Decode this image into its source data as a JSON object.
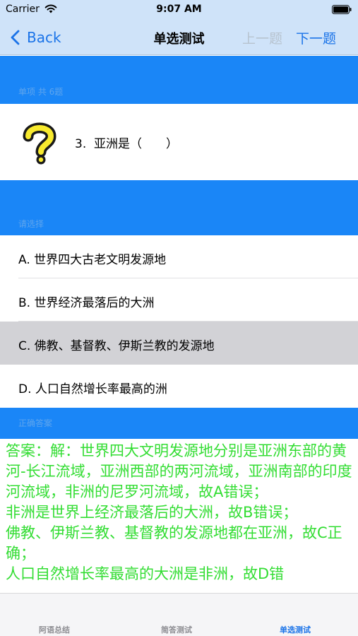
{
  "status_bar": {
    "carrier": "Carrier",
    "time": "9:07 AM"
  },
  "nav": {
    "back_label": "Back",
    "title": "单选测试",
    "prev_label": "上一题",
    "next_label": "下一题"
  },
  "question_section": {
    "header": "单项 共 6题"
  },
  "question": {
    "number": "3.",
    "text": "亚洲是（　　）"
  },
  "options_section": {
    "header": "请选择"
  },
  "options": [
    {
      "label": "A. 世界四大古老文明发源地",
      "selected": false
    },
    {
      "label": "B. 世界经济最落后的大洲",
      "selected": false
    },
    {
      "label": "C. 佛教、基督教、伊斯兰教的发源地",
      "selected": true
    },
    {
      "label": "D. 人口自然增长率最高的洲",
      "selected": false
    }
  ],
  "answer_section": {
    "header": "正确答案"
  },
  "answer": {
    "text": "答案：解：世界四大文明发源地分别是亚洲东部的黄河-长江流域，亚洲西部的两河流域，亚洲南部的印度河流域，非洲的尼罗河流域，故A错误；\n非洲是世界上经济最落后的大洲，故B错误；\n佛教、伊斯兰教、基督教的发源地都在亚洲，故C正确；\n人口自然增长率最高的大洲是非洲，故D错"
  },
  "tabs": [
    {
      "label": "阿语总结",
      "active": false
    },
    {
      "label": "简答测试",
      "active": false
    },
    {
      "label": "单选测试",
      "active": true
    }
  ],
  "colors": {
    "accent": "#1a73e8",
    "band": "#1a86f7",
    "answer": "#33dd33",
    "selected_row": "#d2d2d6"
  },
  "icons": [
    "wifi-icon",
    "battery-icon",
    "back-chevron-icon",
    "question-mark-icon"
  ]
}
